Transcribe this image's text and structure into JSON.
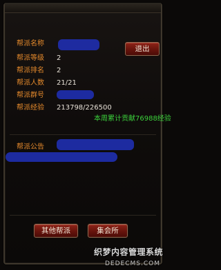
{
  "labels": {
    "name": "帮派名称",
    "level": "帮派等级",
    "rank": "帮派排名",
    "members": "帮派人数",
    "group": "帮派群号",
    "exp": "帮派经验",
    "notice": "帮派公告"
  },
  "values": {
    "level": "2",
    "rank": "2",
    "members": "21/21",
    "exp": "213798/226500",
    "weekly": "本周累计贡献76988经验"
  },
  "buttons": {
    "exit": "退出",
    "other": "其他帮派",
    "hall": "集会所"
  },
  "watermark": {
    "line1": "织梦内容管理系统",
    "line2": "DEDECMS.COM"
  }
}
